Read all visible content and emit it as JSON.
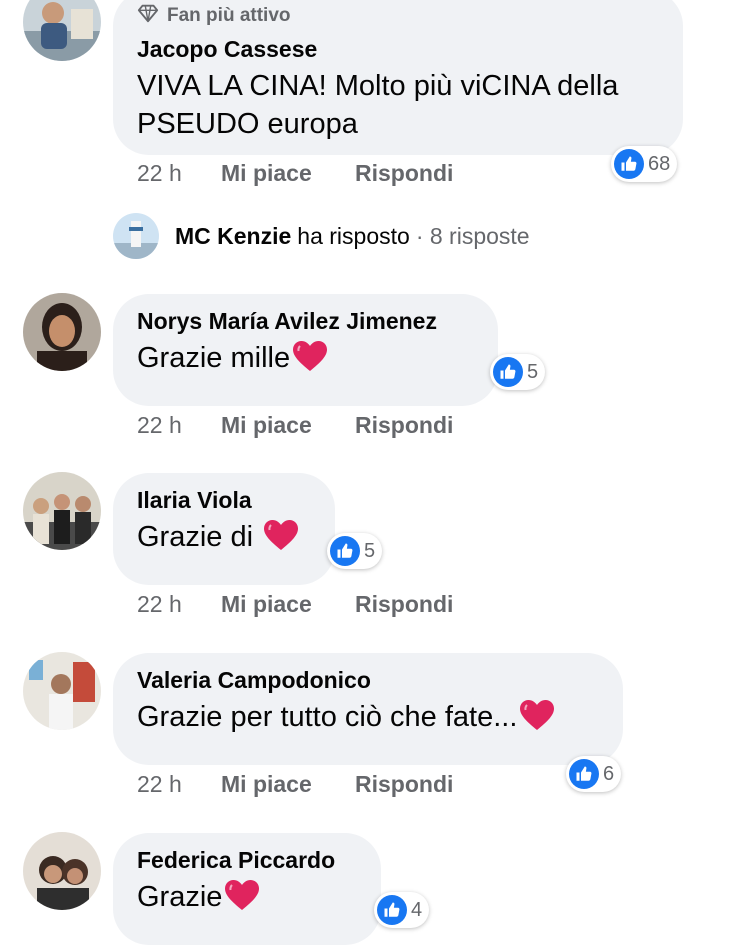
{
  "comments": [
    {
      "badge": "Fan più attivo",
      "author": "Jacopo Cassese",
      "text_lines": [
        "VIVA LA CINA! Molto più viCINA della",
        "PSEUDO europa"
      ],
      "reactions": "68",
      "time": "22 h",
      "like_label": "Mi piace",
      "reply_label": "Rispondi",
      "replies": {
        "name": "MC Kenzie",
        "verb": "ha risposto",
        "count": "· 8 risposte"
      }
    },
    {
      "author": "Norys María Avilez Jimenez",
      "text": "Grazie mille",
      "heart": true,
      "reactions": "5",
      "time": "22 h",
      "like_label": "Mi piace",
      "reply_label": "Rispondi"
    },
    {
      "author": "Ilaria Viola",
      "text": "Grazie di ",
      "heart": true,
      "reactions": "5",
      "time": "22 h",
      "like_label": "Mi piace",
      "reply_label": "Rispondi"
    },
    {
      "author": "Valeria Campodonico",
      "text": "Grazie per tutto ciò che fate...",
      "heart": true,
      "reactions": "6",
      "time": "22 h",
      "like_label": "Mi piace",
      "reply_label": "Rispondi"
    },
    {
      "author": "Federica Piccardo",
      "text": "Grazie",
      "heart": true,
      "reactions": "4"
    }
  ],
  "icons": {
    "badge": "diamond-icon",
    "like": "thumbs-up-icon",
    "heart": "red-heart-emoji"
  },
  "colors": {
    "like_blue": "#1877f2",
    "heart_red": "#e0245e",
    "bubble_bg": "#f0f2f5",
    "secondary_text": "#65676b"
  }
}
